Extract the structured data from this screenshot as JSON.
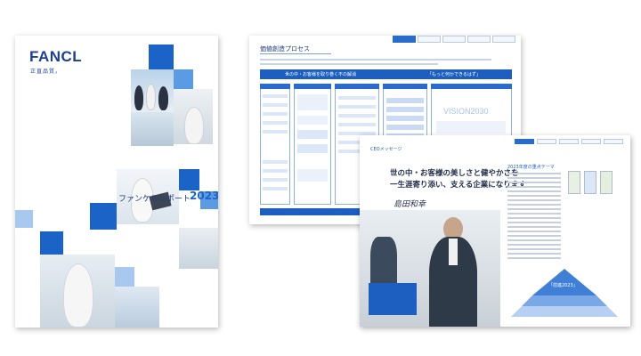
{
  "cover": {
    "logo": "FANCL",
    "logo_tagline": "正直品質。",
    "report_title": "ファンケルレポート",
    "report_year": "2023",
    "brand_color": "#1c63c7"
  },
  "value_creation_spread": {
    "heading": "価値創造プロセス",
    "banner_left": "世の中・お客様を取り巻く不の解消",
    "banner_right": "「もっと何かできるはず」",
    "vision_text": "VISION2030",
    "accent_color": "#1c5fc1"
  },
  "ceo_spread": {
    "label": "CEOメッセージ",
    "headline_line1": "世の中・お客様の美しさと健やかさを",
    "headline_line2": "一生涯寄り添い、支える企業になります",
    "signature": "島田和幸",
    "right_title": "2023年度の重点テーマ",
    "pyramid_label": "「前進2023」",
    "accent_color": "#1c5fc1"
  }
}
